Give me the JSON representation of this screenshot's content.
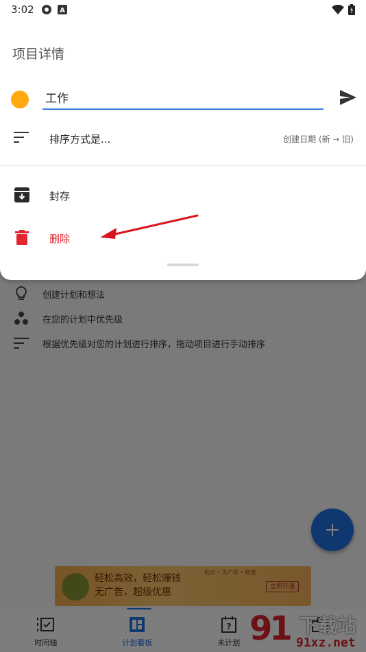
{
  "status_bar": {
    "time": "3:02",
    "left_icons": [
      "settings-gear-icon",
      "font-a-icon"
    ],
    "right_icons": [
      "wifi-icon",
      "battery-charging-icon"
    ]
  },
  "sheet": {
    "title": "项目详情",
    "project_color": "#FFA80F",
    "project_name": "工作",
    "sort": {
      "label": "排序方式是...",
      "value": "创建日期 (新 → 旧)"
    },
    "actions": {
      "archive_label": "封存",
      "delete_label": "删除"
    }
  },
  "background": {
    "hints": [
      {
        "icon": "lightbulb-icon",
        "text": "创建计划和想法"
      },
      {
        "icon": "priority-dots-icon",
        "text": "在您的计划中优先级"
      },
      {
        "icon": "sort-lines-icon",
        "text": "根据优先级对您的计划进行排序，拖动项目进行手动排序"
      }
    ],
    "ad": {
      "line1": "轻松高效，轻松赚钱",
      "line2": "无广告，超级优惠",
      "tags": "低价 • 无广告 • 特惠",
      "button": "立即开通"
    },
    "bottom_nav": [
      {
        "label": "时间轴",
        "icon": "timeline-check-icon",
        "active": false
      },
      {
        "label": "计划看板",
        "icon": "board-icon",
        "active": true
      },
      {
        "label": "未计划",
        "icon": "calendar-question-icon",
        "active": false
      },
      {
        "label": "",
        "icon": "briefcase-icon",
        "active": false
      }
    ]
  },
  "watermark": {
    "logo": "91",
    "cn": "下载站",
    "url": "91xz.net"
  },
  "colors": {
    "accent": "#1E6FE0",
    "delete": "#E0262E",
    "input_underline": "#3C7FE0"
  }
}
